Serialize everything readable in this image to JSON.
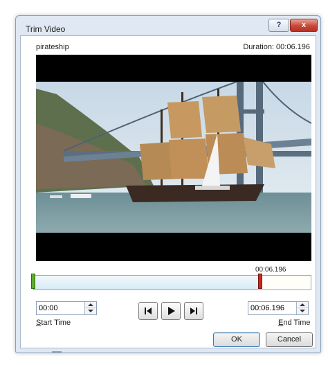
{
  "dialog": {
    "title": "Trim Video",
    "help_label": "?",
    "close_label": "x"
  },
  "video": {
    "name": "pirateship",
    "duration": "Duration: 00:06.196"
  },
  "trim": {
    "end_marker_time": "00:06.196",
    "end_fraction": 0.815,
    "start_value": "00:00",
    "end_value": "00:06.196",
    "start_label_accel": "S",
    "start_label_rest": "tart Time",
    "end_label_accel": "E",
    "end_label_rest": "nd Time"
  },
  "controls": {
    "prev_frame_icon": "previous-frame-icon",
    "play_icon": "play-icon",
    "next_frame_icon": "next-frame-icon"
  },
  "buttons": {
    "ok": "OK",
    "cancel": "Cancel"
  },
  "colors": {
    "start_handle": "#5dab2c",
    "end_handle": "#c8281e"
  }
}
